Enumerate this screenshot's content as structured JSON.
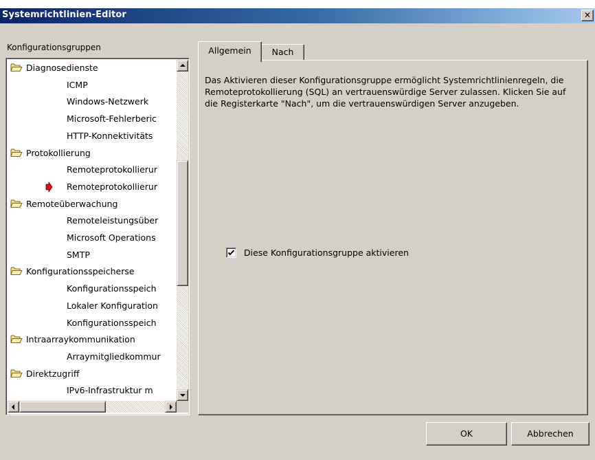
{
  "window": {
    "title": "Systemrichtlinien-Editor",
    "close_glyph": "✕"
  },
  "left_panel": {
    "label": "Konfigurationsgruppen",
    "tree": [
      {
        "label": "Diagnosedienste",
        "level": 0,
        "icon": "folder-open-icon"
      },
      {
        "label": "ICMP",
        "level": 1
      },
      {
        "label": "Windows-Netzwerk",
        "level": 1
      },
      {
        "label": "Microsoft-Fehlerberic",
        "level": 1
      },
      {
        "label": "HTTP-Konnektivitäts",
        "level": 1
      },
      {
        "label": "Protokollierung",
        "level": 0,
        "icon": "folder-open-icon"
      },
      {
        "label": "Remoteprotokollierur",
        "level": 1
      },
      {
        "label": "Remoteprotokollierur",
        "level": 1,
        "selected_marker": "red-arrow-icon"
      },
      {
        "label": "Remoteüberwachung",
        "level": 0,
        "icon": "folder-open-icon"
      },
      {
        "label": "Remoteleistungsüber",
        "level": 1
      },
      {
        "label": "Microsoft Operations",
        "level": 1
      },
      {
        "label": "SMTP",
        "level": 1
      },
      {
        "label": "Konfigurationsspeicherse",
        "level": 0,
        "icon": "folder-open-icon"
      },
      {
        "label": "Konfigurationsspeich",
        "level": 1
      },
      {
        "label": "Lokaler Konfiguration",
        "level": 1
      },
      {
        "label": "Konfigurationsspeich",
        "level": 1
      },
      {
        "label": "Intraarraykommunikation",
        "level": 0,
        "icon": "folder-open-icon"
      },
      {
        "label": "Arraymitgliedkommur",
        "level": 1
      },
      {
        "label": "Direktzugriff",
        "level": 0,
        "icon": "folder-open-icon"
      },
      {
        "label": "IPv6-Infrastruktur m",
        "level": 1
      }
    ]
  },
  "tabs": [
    {
      "label": "Allgemein",
      "active": true
    },
    {
      "label": "Nach",
      "active": false
    }
  ],
  "general_tab": {
    "description": "Das Aktivieren dieser Konfigurationsgruppe ermöglicht Systemrichtlinienregeln, die Remoteprotokollierung (SQL) an vertrauenswürdige Server zulassen. Klicken Sie auf die Registerkarte \"Nach\", um die vertrauenswürdigen Server anzugeben.",
    "enable_checkbox": {
      "label": "Diese Konfigurationsgruppe aktivieren",
      "checked": true
    }
  },
  "buttons": {
    "ok": "OK",
    "cancel": "Abbrechen"
  }
}
